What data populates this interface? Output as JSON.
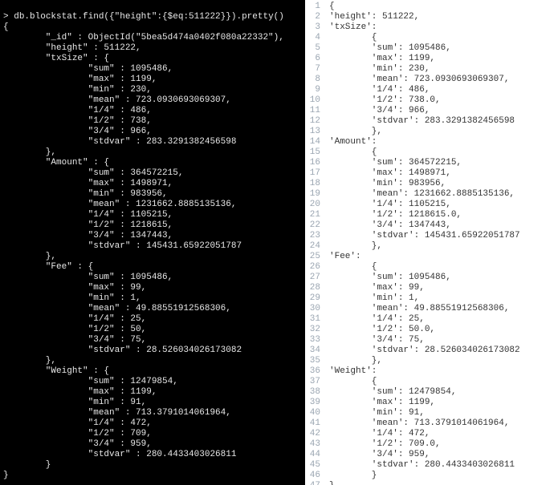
{
  "terminal": {
    "prompt_glyph": ">",
    "command": "db.blockstat.find({\"height\":{$eq:511222}}).pretty()",
    "output_lines": [
      "{",
      "        \"_id\" : ObjectId(\"5bea5d474a0402f080a22332\"),",
      "        \"height\" : 511222,",
      "        \"txSize\" : {",
      "                \"sum\" : 1095486,",
      "                \"max\" : 1199,",
      "                \"min\" : 230,",
      "                \"mean\" : 723.0930693069307,",
      "                \"1/4\" : 486,",
      "                \"1/2\" : 738,",
      "                \"3/4\" : 966,",
      "                \"stdvar\" : 283.3291382456598",
      "        },",
      "        \"Amount\" : {",
      "                \"sum\" : 364572215,",
      "                \"max\" : 1498971,",
      "                \"min\" : 983956,",
      "                \"mean\" : 1231662.8885135136,",
      "                \"1/4\" : 1105215,",
      "                \"1/2\" : 1218615,",
      "                \"3/4\" : 1347443,",
      "                \"stdvar\" : 145431.65922051787",
      "        },",
      "        \"Fee\" : {",
      "                \"sum\" : 1095486,",
      "                \"max\" : 99,",
      "                \"min\" : 1,",
      "                \"mean\" : 49.88551912568306,",
      "                \"1/4\" : 25,",
      "                \"1/2\" : 50,",
      "                \"3/4\" : 75,",
      "                \"stdvar\" : 28.526034026173082",
      "        },",
      "        \"Weight\" : {",
      "                \"sum\" : 12479854,",
      "                \"max\" : 1199,",
      "                \"min\" : 91,",
      "                \"mean\" : 713.3791014061964,",
      "                \"1/4\" : 472,",
      "                \"1/2\" : 709,",
      "                \"3/4\" : 959,",
      "                \"stdvar\" : 280.4433403026811",
      "        }",
      "}"
    ]
  },
  "editor": {
    "line_start": 1,
    "line_end": 47,
    "lines": [
      "{",
      "'height': 511222,",
      "'txSize':",
      "        {",
      "        'sum': 1095486,",
      "        'max': 1199,",
      "        'min': 230,",
      "        'mean': 723.0930693069307,",
      "        '1/4': 486,",
      "        '1/2': 738.0,",
      "        '3/4': 966,",
      "        'stdvar': 283.3291382456598",
      "        },",
      "'Amount':",
      "        {",
      "        'sum': 364572215,",
      "        'max': 1498971,",
      "        'min': 983956,",
      "        'mean': 1231662.8885135136,",
      "        '1/4': 1105215,",
      "        '1/2': 1218615.0,",
      "        '3/4': 1347443,",
      "        'stdvar': 145431.65922051787",
      "        },",
      "'Fee':",
      "        {",
      "        'sum': 1095486,",
      "        'max': 99,",
      "        'min': 1,",
      "        'mean': 49.88551912568306,",
      "        '1/4': 25,",
      "        '1/2': 50.0,",
      "        '3/4': 75,",
      "        'stdvar': 28.526034026173082",
      "        },",
      "'Weight':",
      "        {",
      "        'sum': 12479854,",
      "        'max': 1199,",
      "        'min': 91,",
      "        'mean': 713.3791014061964,",
      "        '1/4': 472,",
      "        '1/2': 709.0,",
      "        '3/4': 959,",
      "        'stdvar': 280.4433403026811",
      "        }",
      "}"
    ]
  }
}
